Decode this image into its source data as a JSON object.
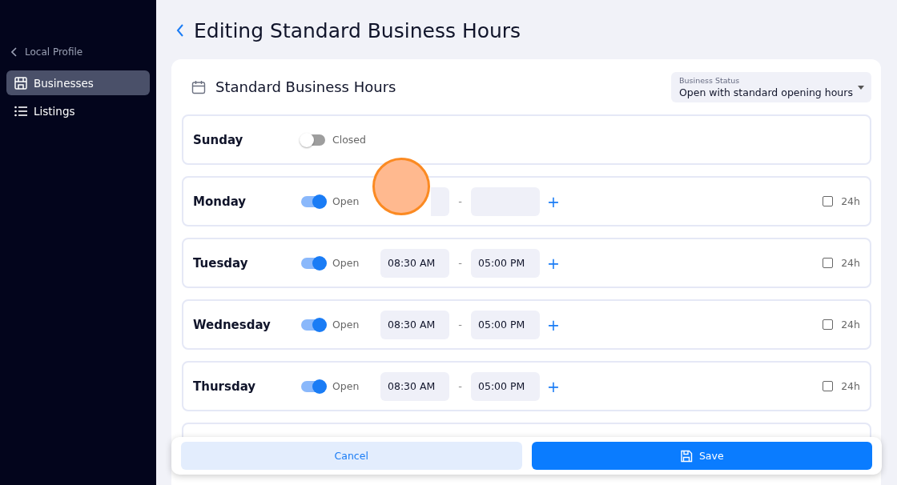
{
  "sidebar": {
    "back_link": "Local Profile",
    "items": [
      {
        "label": "Businesses",
        "selected": true
      },
      {
        "label": "Listings",
        "selected": false
      }
    ]
  },
  "page_title": "Editing Standard Business Hours",
  "card": {
    "title": "Standard Business Hours",
    "status": {
      "label": "Business Status",
      "value": "Open with standard opening hours"
    }
  },
  "days": [
    {
      "kind": "closed",
      "day": "Sunday",
      "open": false,
      "status": "Closed"
    },
    {
      "kind": "covered",
      "day": "Monday",
      "open": true,
      "status": "Open",
      "all_day_label": "24h",
      "all_day": false
    },
    {
      "day": "Tuesday",
      "open": true,
      "status": "Open",
      "from": "08:30 AM",
      "to": "05:00 PM",
      "all_day_label": "24h",
      "all_day": false
    },
    {
      "day": "Wednesday",
      "open": true,
      "status": "Open",
      "from": "08:30 AM",
      "to": "05:00 PM",
      "all_day_label": "24h",
      "all_day": false
    },
    {
      "day": "Thursday",
      "open": true,
      "status": "Open",
      "from": "08:30 AM",
      "to": "05:00 PM",
      "all_day_label": "24h",
      "all_day": false
    },
    {
      "kind": "partial"
    }
  ],
  "separator": "-",
  "add_symbol": "+",
  "footer": {
    "cancel": "Cancel",
    "save": "Save"
  }
}
